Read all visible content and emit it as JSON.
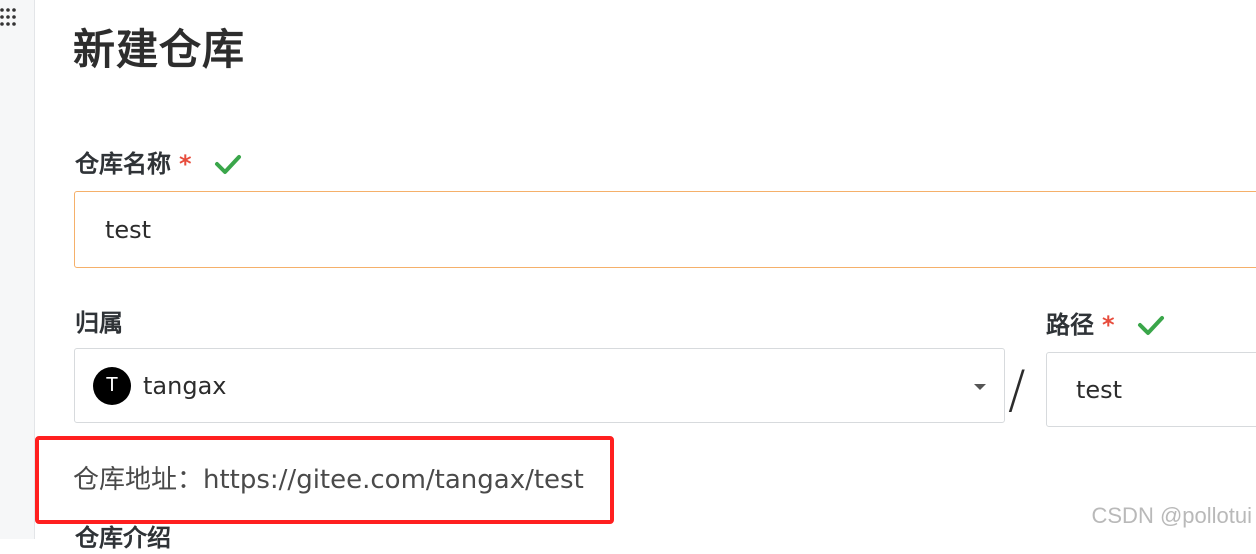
{
  "page": {
    "title": "新建仓库",
    "url_label": "仓库地址：https://gitee.com/tangax/test",
    "next_section_label": "仓库介绍",
    "watermark": "CSDN @pollotui"
  },
  "fields": {
    "repo_name": {
      "label": "仓库名称",
      "required_mark": "*",
      "value": "test",
      "valid": true
    },
    "owner": {
      "label": "归属",
      "avatar_letter": "T",
      "value": "tangax"
    },
    "path": {
      "label": "路径",
      "required_mark": "*",
      "value": "test",
      "valid": true
    },
    "separator": "/"
  },
  "icons": {
    "check": "check-icon",
    "dropdown": "chevron-down-icon",
    "grid": "grid-dots-icon"
  },
  "colors": {
    "required": "#e74c3c",
    "valid_check": "#3aa64a",
    "focus_border": "#f5b06a",
    "highlight_box": "#ff1f1f"
  }
}
